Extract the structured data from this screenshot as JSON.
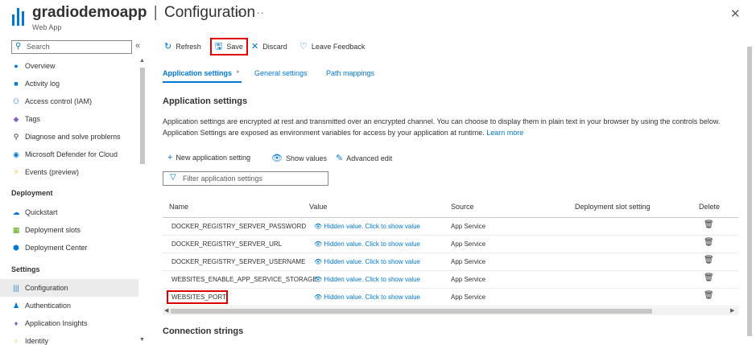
{
  "header": {
    "resource_name": "gradiodemoapp",
    "separator": "|",
    "page_name": "Configuration",
    "subtitle": "Web App",
    "favorite_icon": "☆",
    "more_icon": "···",
    "close_icon": "✕"
  },
  "sidebar": {
    "search_placeholder": "Search",
    "collapse_icon": "«",
    "items_top": [
      {
        "label": "Overview",
        "icon": "globe-icon",
        "glyph": "●",
        "color": "#0078d4"
      },
      {
        "label": "Activity log",
        "icon": "activity-log-icon",
        "glyph": "■",
        "color": "#0078d4"
      },
      {
        "label": "Access control (IAM)",
        "icon": "people-icon",
        "glyph": "⚇",
        "color": "#0078d4"
      },
      {
        "label": "Tags",
        "icon": "tag-icon",
        "glyph": "◆",
        "color": "#8661c5"
      },
      {
        "label": "Diagnose and solve problems",
        "icon": "wrench-icon",
        "glyph": "⚲",
        "color": "#323130"
      },
      {
        "label": "Microsoft Defender for Cloud",
        "icon": "shield-icon",
        "glyph": "◉",
        "color": "#0078d4"
      },
      {
        "label": "Events (preview)",
        "icon": "lightning-icon",
        "glyph": "⚡",
        "color": "#ffb900"
      }
    ],
    "section_deployment": "Deployment",
    "items_deployment": [
      {
        "label": "Quickstart",
        "icon": "cloud-icon",
        "glyph": "☁",
        "color": "#0078d4"
      },
      {
        "label": "Deployment slots",
        "icon": "slots-icon",
        "glyph": "▦",
        "color": "#57a300"
      },
      {
        "label": "Deployment Center",
        "icon": "cube-icon",
        "glyph": "⬢",
        "color": "#0078d4"
      }
    ],
    "section_settings": "Settings",
    "items_settings": [
      {
        "label": "Configuration",
        "icon": "configuration-icon",
        "glyph": "|||",
        "color": "#0078d4"
      },
      {
        "label": "Authentication",
        "icon": "authentication-icon",
        "glyph": "♟",
        "color": "#0078d4"
      },
      {
        "label": "Application Insights",
        "icon": "insights-icon",
        "glyph": "♦",
        "color": "#8661c5"
      },
      {
        "label": "Identity",
        "icon": "identity-icon",
        "glyph": "♀",
        "color": "#ffb900"
      }
    ]
  },
  "toolbar": {
    "refresh_label": "Refresh",
    "save_label": "Save",
    "discard_label": "Discard",
    "feedback_label": "Leave Feedback"
  },
  "tabs": {
    "application_settings": "Application settings",
    "application_settings_marker": "*",
    "general_settings": "General settings",
    "path_mappings": "Path mappings"
  },
  "main": {
    "heading": "Application settings",
    "description": "Application settings are encrypted at rest and transmitted over an encrypted channel. You can choose to display them in plain text in your browser by using the controls below. Application Settings are exposed as environment variables for access by your application at runtime.",
    "learn_more": "Learn more",
    "new_setting_label": "New application setting",
    "show_values_label": "Show values",
    "advanced_edit_label": "Advanced edit",
    "filter_placeholder": "Filter application settings",
    "connection_strings_heading": "Connection strings"
  },
  "table": {
    "columns": [
      "Name",
      "Value",
      "Source",
      "Deployment slot setting",
      "Delete"
    ],
    "rows": [
      {
        "name": "DOCKER_REGISTRY_SERVER_PASSWORD",
        "value": "Hidden value. Click to show value",
        "source": "App Service"
      },
      {
        "name": "DOCKER_REGISTRY_SERVER_URL",
        "value": "Hidden value. Click to show value",
        "source": "App Service"
      },
      {
        "name": "DOCKER_REGISTRY_SERVER_USERNAME",
        "value": "Hidden value. Click to show value",
        "source": "App Service"
      },
      {
        "name": "WEBSITES_ENABLE_APP_SERVICE_STORAGE",
        "value": "Hidden value. Click to show value",
        "source": "App Service"
      },
      {
        "name": "WEBSITES_PORT",
        "value": "Hidden value. Click to show value",
        "source": "App Service"
      }
    ]
  },
  "colors": {
    "accent": "#0078d4",
    "highlight": "#e00000"
  }
}
